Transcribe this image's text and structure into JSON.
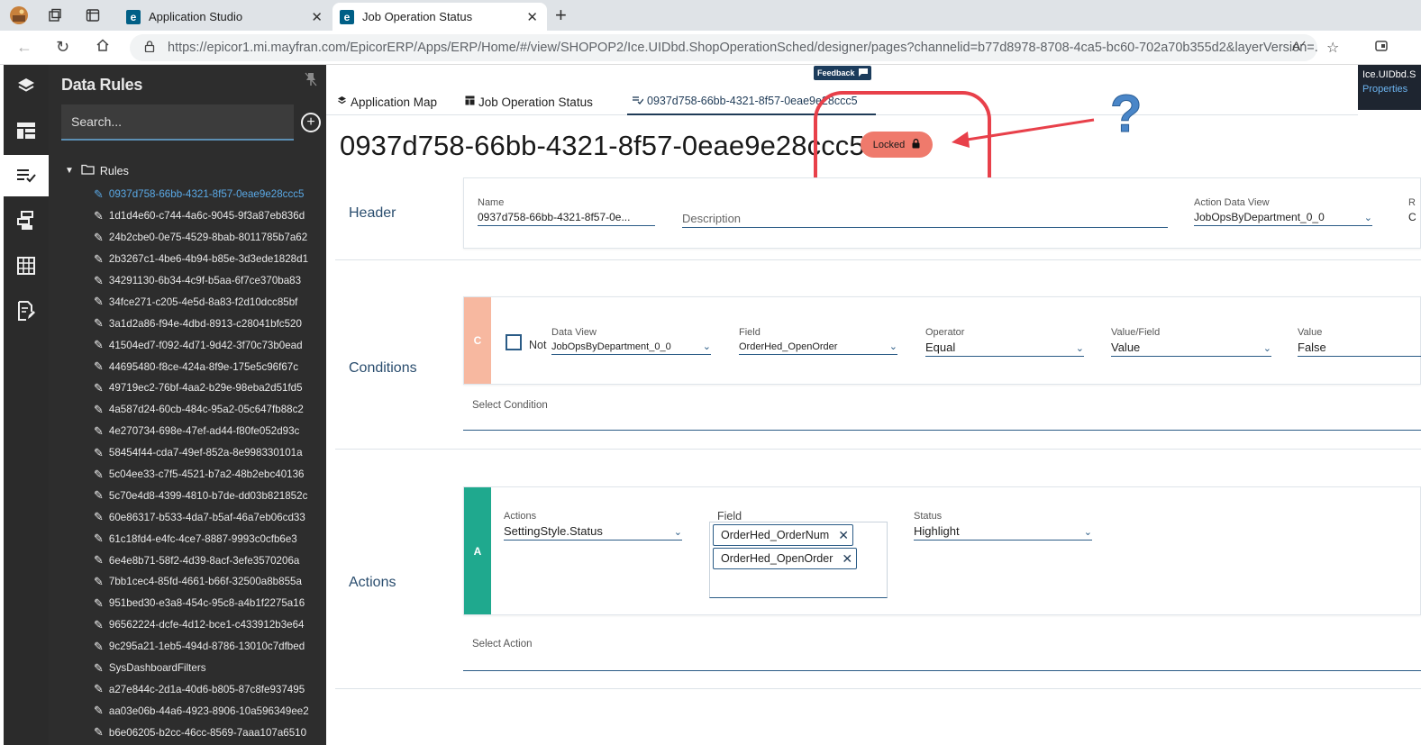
{
  "browser": {
    "tabs": [
      {
        "label": "Application Studio"
      },
      {
        "label": "Job Operation Status"
      }
    ],
    "url_main": "https://epicor1.mi.mayfran.com/EpicorERP/Apps/ERP/Home/#/view/SHOPOP2/Ice.UIDbd.ShopOperationSched/designer/pages?channelid=b77d8978-8708-4ca5-bc60-702a70b355d2&layerVersion=..."
  },
  "panel": {
    "title": "Data Rules",
    "search_placeholder": "Search...",
    "tree_root": "Rules",
    "rules": [
      "0937d758-66bb-4321-8f57-0eae9e28ccc5",
      "1d1d4e60-c744-4a6c-9045-9f3a87eb836d",
      "24b2cbe0-0e75-4529-8bab-8011785b7a62",
      "2b3267c1-4be6-4b94-b85e-3d3ede1828d1",
      "34291130-6b34-4c9f-b5aa-6f7ce370ba83",
      "34fce271-c205-4e5d-8a83-f2d10dcc85bf",
      "3a1d2a86-f94e-4dbd-8913-c28041bfc520",
      "41504ed7-f092-4d71-9d42-3f70c73b0ead",
      "44695480-f8ce-424a-8f9e-175e5c96f67c",
      "49719ec2-76bf-4aa2-b29e-98eba2d51fd5",
      "4a587d24-60cb-484c-95a2-05c647fb88c2",
      "4e270734-698e-47ef-ad44-f80fe052d93c",
      "58454f44-cda7-49ef-852a-8e998330101a",
      "5c04ee33-c7f5-4521-b7a2-48b2ebc40136",
      "5c70e4d8-4399-4810-b7de-dd03b821852c",
      "60e86317-b533-4da7-b5af-46a7eb06cd33",
      "61c18fd4-e4fc-4ce7-8887-9993c0cfb6e3",
      "6e4e8b71-58f2-4d39-8acf-3efe3570206a",
      "7bb1cec4-85fd-4661-b66f-32500a8b855a",
      "951bed30-e3a8-454c-95c8-a4b1f2275a16",
      "96562224-dcfe-4d12-bce1-c433912b3e64",
      "9c295a21-1eb5-494d-8786-13010c7dfbed",
      "SysDashboardFilters",
      "a27e844c-2d1a-40d6-b805-87c8fe937495",
      "aa03e06b-44a6-4923-8906-10a596349ee2",
      "b6e06205-b2cc-46cc-8569-7aaa107a6510"
    ]
  },
  "main": {
    "feedback": "Feedback",
    "properties_header": "Ice.UIDbd.S",
    "properties_link": "Properties",
    "tabs": [
      {
        "label": "Application Map"
      },
      {
        "label": "Job Operation Status"
      },
      {
        "label": "0937d758-66bb-4321-8f57-0eae9e28ccc5"
      }
    ],
    "title": "0937d758-66bb-4321-8f57-0eae9e28ccc5",
    "locked": "Locked",
    "annotation": "?",
    "header": {
      "label": "Header",
      "name_label": "Name",
      "name_value": "0937d758-66bb-4321-8f57-0e...",
      "description_placeholder": "Description",
      "action_dv_label": "Action Data View",
      "action_dv_value": "JobOpsByDepartment_0_0",
      "cut_label": "R",
      "cut_value": "C"
    },
    "conditions": {
      "label": "Conditions",
      "block": "C",
      "not_label": "Not",
      "dataview_label": "Data View",
      "dataview_value": "JobOpsByDepartment_0_0",
      "field_label": "Field",
      "field_value": "OrderHed_OpenOrder",
      "operator_label": "Operator",
      "operator_value": "Equal",
      "valuefield_label": "Value/Field",
      "valuefield_value": "Value",
      "value_label": "Value",
      "value_value": "False",
      "select_condition": "Select Condition"
    },
    "actions": {
      "label": "Actions",
      "block": "A",
      "actions_label": "Actions",
      "actions_value": "SettingStyle.Status",
      "field_label": "Field",
      "chips": [
        "OrderHed_OrderNum",
        "OrderHed_OpenOrder"
      ],
      "status_label": "Status",
      "status_value": "Highlight",
      "select_action": "Select Action"
    }
  },
  "colors": {
    "condition_block": "#f7b8a0",
    "action_block": "#1fa98e",
    "locked_badge": "#ef7a6c",
    "annotation_red": "#e8404a",
    "annotation_blue": "#4a86c8"
  }
}
